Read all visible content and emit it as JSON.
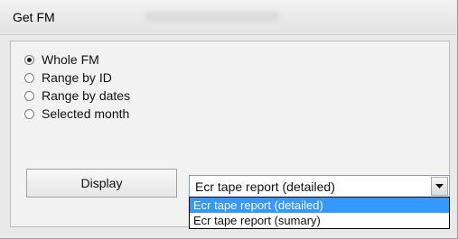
{
  "window": {
    "title": "Get FM"
  },
  "scope": {
    "options": [
      {
        "label": "Whole FM",
        "checked": true
      },
      {
        "label": "Range by ID",
        "checked": false
      },
      {
        "label": "Range by dates",
        "checked": false
      },
      {
        "label": "Selected month",
        "checked": false
      }
    ]
  },
  "actions": {
    "display_label": "Display"
  },
  "report": {
    "selected": "Ecr tape report (detailed)",
    "options": [
      {
        "label": "Ecr tape report (detailed)",
        "highlighted": true
      },
      {
        "label": "Ecr tape report (sumary)",
        "highlighted": false
      }
    ]
  },
  "colors": {
    "highlight": "#3399ff",
    "window_bg": "#e9e9e9"
  },
  "icons": {
    "combo_arrow": "chevron-down-icon",
    "radio": "radio-button-icon"
  }
}
